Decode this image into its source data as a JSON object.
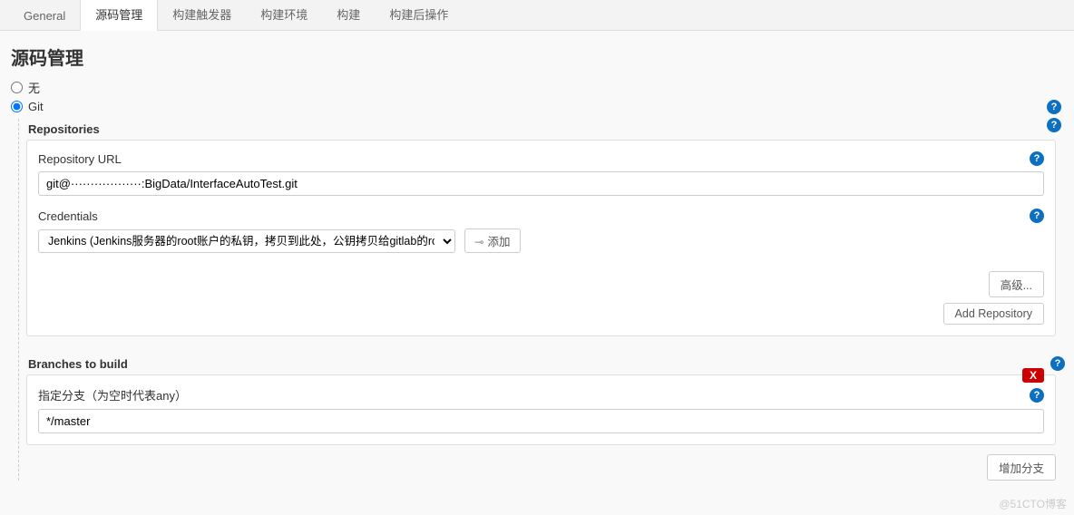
{
  "tabs": {
    "general": "General",
    "scm": "源码管理",
    "triggers": "构建触发器",
    "env": "构建环境",
    "build": "构建",
    "post": "构建后操作"
  },
  "section_title": "源码管理",
  "scm": {
    "none_label": "无",
    "git_label": "Git",
    "repositories_label": "Repositories",
    "repo_url_label": "Repository URL",
    "repo_url_value": "git@··················:BigData/InterfaceAutoTest.git",
    "credentials_label": "Credentials",
    "credentials_value": "Jenkins (Jenkins服务器的root账户的私钥，拷贝到此处，公钥拷贝给gitlab的root下)",
    "add_cred_label": "添加",
    "advanced_btn": "高级...",
    "add_repo_btn": "Add Repository",
    "branches_label": "Branches to build",
    "branch_spec_label": "指定分支（为空时代表any）",
    "branch_value": "*/master",
    "add_branch_btn": "增加分支",
    "delete_x": "X"
  },
  "help_glyph": "?",
  "watermark": "@51CTO博客"
}
